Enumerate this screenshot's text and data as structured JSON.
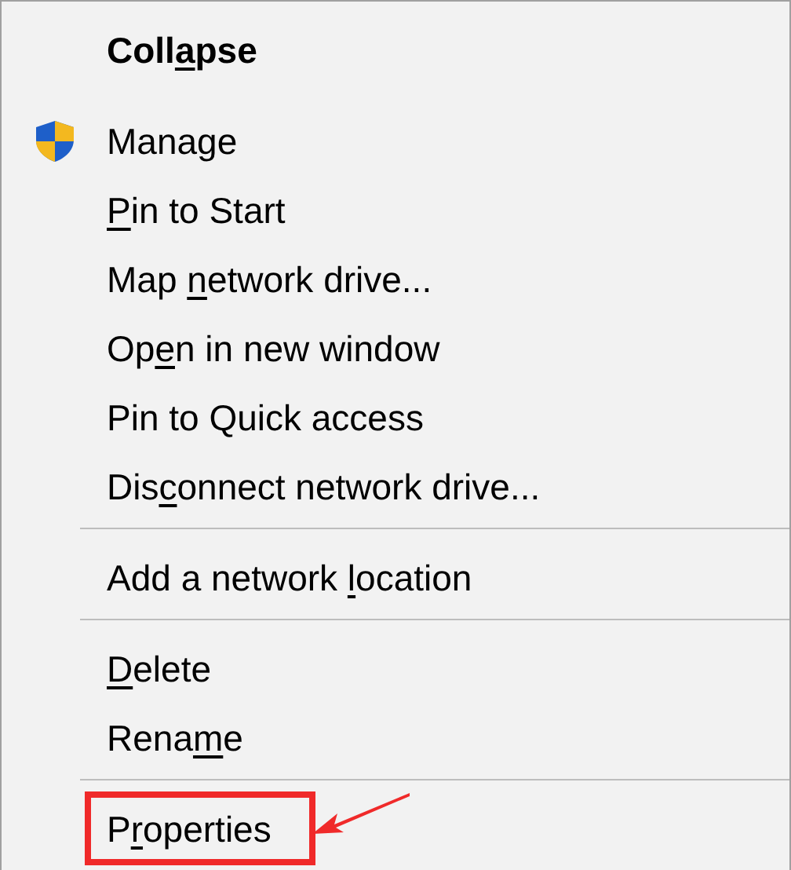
{
  "menu": {
    "sections": [
      {
        "items": [
          {
            "label": "Coll",
            "accelerator": "a",
            "label_rest": "pse",
            "bold": true
          },
          {
            "label": "Manage",
            "bold": false,
            "has_icon": true
          },
          {
            "accelerator": "P",
            "label_rest": "in to Start",
            "bold": false
          },
          {
            "label": "Map ",
            "accelerator": "n",
            "label_rest": "etwork drive...",
            "bold": false
          },
          {
            "label": "Op",
            "accelerator": "e",
            "label_rest": "n in new window",
            "bold": false
          },
          {
            "label": "Pin to Quick access",
            "bold": false
          },
          {
            "label": "Dis",
            "accelerator": "c",
            "label_rest": "onnect network drive...",
            "bold": false
          }
        ]
      },
      {
        "items": [
          {
            "label": "Add a network ",
            "accelerator": "l",
            "label_rest": "ocation",
            "bold": false
          }
        ]
      },
      {
        "items": [
          {
            "accelerator": "D",
            "label_rest": "elete",
            "bold": false
          },
          {
            "label": "Rena",
            "accelerator": "m",
            "label_rest": "e",
            "bold": false
          }
        ]
      },
      {
        "items": [
          {
            "label": "P",
            "accelerator": "r",
            "label_rest": "operties",
            "bold": false,
            "highlighted": true
          }
        ]
      }
    ]
  }
}
